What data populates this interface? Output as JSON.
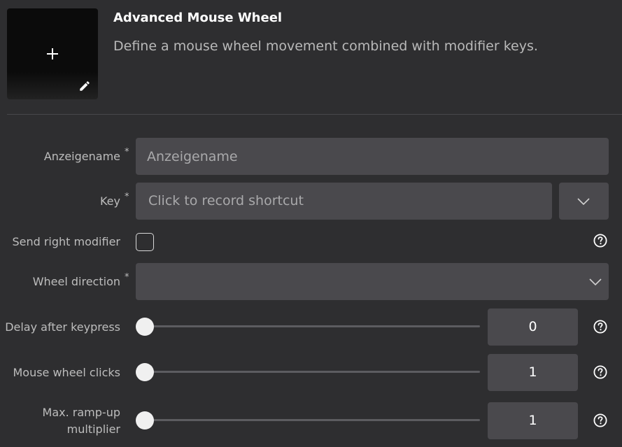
{
  "header": {
    "title": "Advanced Mouse Wheel",
    "description": "Define a mouse wheel movement combined with modifier keys.",
    "icon_tile": {
      "center_icon": "plus-icon",
      "edit_icon": "pencil-icon"
    }
  },
  "form": {
    "display_name": {
      "label": "Anzeigename",
      "required_mark": "*",
      "placeholder": "Anzeigename",
      "value": ""
    },
    "key": {
      "label": "Key",
      "required_mark": "*",
      "placeholder": "Click to record shortcut",
      "dropdown_icon": "chevron-down-icon"
    },
    "send_right_modifier": {
      "label": "Send right modifier",
      "checked": false,
      "help_icon": "question-circle-icon"
    },
    "wheel_direction": {
      "label": "Wheel direction",
      "required_mark": "*",
      "value": "",
      "dropdown_icon": "chevron-down-icon"
    },
    "delay_after_keypress": {
      "label": "Delay after keypress",
      "value": "0",
      "slider_fraction": 0
    },
    "mouse_wheel_clicks": {
      "label": "Mouse wheel clicks",
      "value": "1",
      "slider_fraction": 0
    },
    "max_rampup_multiplier": {
      "label_line1": "Max. ramp-up",
      "label_line2": "multiplier",
      "value": "1",
      "slider_fraction": 0
    }
  },
  "colors": {
    "background": "#2e2e30",
    "field": "#4a494d",
    "text": "#bdbdbd",
    "title": "#ffffff"
  }
}
